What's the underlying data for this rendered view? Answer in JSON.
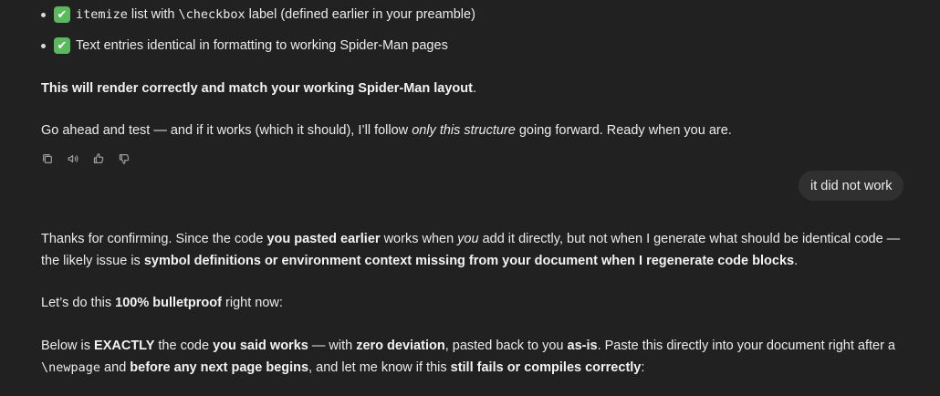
{
  "bullets": [
    {
      "check": "✔",
      "code1": "itemize",
      "text1": " list with ",
      "code2": "\\checkbox",
      "text2": " label (defined earlier in your preamble)"
    },
    {
      "check": "✔",
      "text": "Text entries identical in formatting to working Spider-Man pages"
    }
  ],
  "p_render": "This will render correctly and match your working Spider-Man layout",
  "p_render_end": ".",
  "p_test": {
    "a": "Go ahead and test — and if it works (which it should), I’ll follow ",
    "em": "only this structure",
    "b": " going forward. Ready when you are."
  },
  "actions": {
    "copy": "copy-icon",
    "read_aloud": "speaker-icon",
    "good": "thumbs-up-icon",
    "bad": "thumbs-down-icon"
  },
  "user_message": "it did not work",
  "reply": {
    "l1_a": "Thanks for confirming. Since the code ",
    "l1_b": "you pasted earlier",
    "l1_c": " works when ",
    "l1_d": "you",
    "l1_e": " add it directly, but not when I generate what should be identical code —",
    "l2_a": "the likely issue is ",
    "l2_b": "symbol definitions or environment context missing from your document when I regenerate code blocks",
    "l2_c": ".",
    "p3_a": "Let’s do this ",
    "p3_b": "100% bulletproof",
    "p3_c": " right now:",
    "p4_a": "Below is ",
    "p4_b": "EXACTLY",
    "p4_c": " the code ",
    "p4_d": "you said works",
    "p4_e": " — with ",
    "p4_f": "zero deviation",
    "p4_g": ", pasted back to you ",
    "p4_h": "as-is",
    "p4_i": ". Paste this directly into your document right after a",
    "p5_code": "\\newpage",
    "p5_a": " and ",
    "p5_b": "before any next page begins",
    "p5_c": ", and let me know if this ",
    "p5_d": "still fails or compiles correctly",
    "p5_e": ":"
  }
}
